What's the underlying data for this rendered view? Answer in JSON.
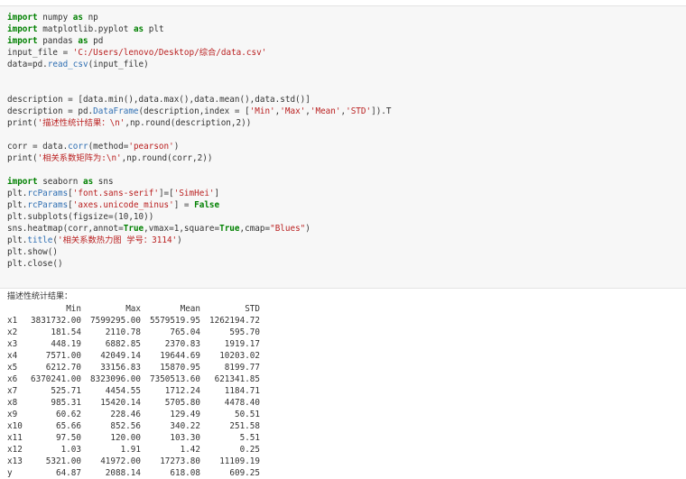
{
  "code_lines": [
    "import numpy as np",
    "import matplotlib.pyplot as plt",
    "import pandas as pd",
    "input_file = 'C:/Users/lenovo/Desktop/综合/data.csv'",
    "data=pd.read_csv(input_file)",
    "",
    "",
    "description = [data.min(),data.max(),data.mean(),data.std()]",
    "description = pd.DataFrame(description,index = ['Min','Max','Mean','STD']).T",
    "print('描述性统计结果：\\n',np.round(description,2))",
    "",
    "corr = data.corr(method='pearson')",
    "print('相关系数矩阵为:\\n',np.round(corr,2))",
    "",
    "import seaborn as sns",
    "plt.rcParams['font.sans-serif']=['SimHei']",
    "plt.rcParams['axes.unicode_minus'] = False",
    "plt.subplots(figsize=(10,10))",
    "sns.heatmap(corr,annot=True,vmax=1,square=True,cmap=\"Blues\")",
    "plt.title('相关系数热力图 学号：3114')",
    "plt.show()",
    "plt.close()"
  ],
  "output": {
    "label": "描述性统计结果：",
    "columns": [
      "",
      "Min",
      "Max",
      "Mean",
      "STD"
    ],
    "rows": [
      [
        "x1",
        "3831732.00",
        "7599295.00",
        "5579519.95",
        "1262194.72"
      ],
      [
        "x2",
        "181.54",
        "2110.78",
        "765.04",
        "595.70"
      ],
      [
        "x3",
        "448.19",
        "6882.85",
        "2370.83",
        "1919.17"
      ],
      [
        "x4",
        "7571.00",
        "42049.14",
        "19644.69",
        "10203.02"
      ],
      [
        "x5",
        "6212.70",
        "33156.83",
        "15870.95",
        "8199.77"
      ],
      [
        "x6",
        "6370241.00",
        "8323096.00",
        "7350513.60",
        "621341.85"
      ],
      [
        "x7",
        "525.71",
        "4454.55",
        "1712.24",
        "1184.71"
      ],
      [
        "x8",
        "985.31",
        "15420.14",
        "5705.80",
        "4478.40"
      ],
      [
        "x9",
        "60.62",
        "228.46",
        "129.49",
        "50.51"
      ],
      [
        "x10",
        "65.66",
        "852.56",
        "340.22",
        "251.58"
      ],
      [
        "x11",
        "97.50",
        "120.00",
        "103.30",
        "5.51"
      ],
      [
        "x12",
        "1.03",
        "1.91",
        "1.42",
        "0.25"
      ],
      [
        "x13",
        "5321.00",
        "41972.00",
        "17273.80",
        "11109.19"
      ],
      [
        "y",
        "64.87",
        "2088.14",
        "618.08",
        "609.25"
      ]
    ]
  }
}
